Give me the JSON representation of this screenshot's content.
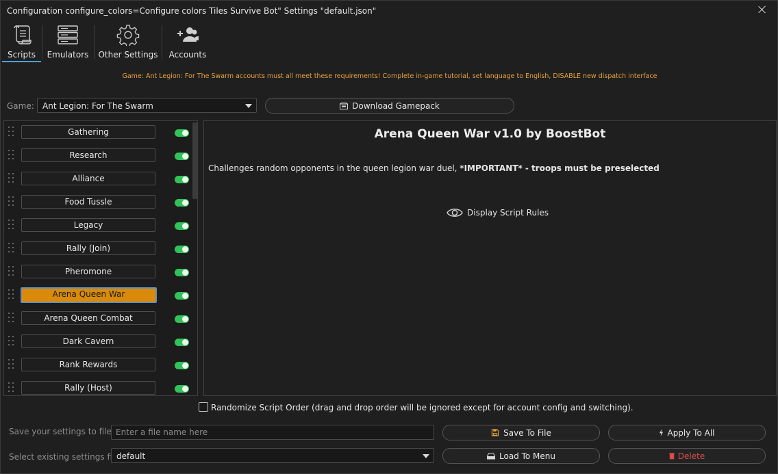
{
  "window": {
    "title": "Configuration configure_colors=Configure colors Tiles Survive Bot\" Settings \"default.json\""
  },
  "tabs": [
    {
      "label": "Scripts",
      "icon": "scroll-icon",
      "active": true
    },
    {
      "label": "Emulators",
      "icon": "server-icon",
      "active": false
    },
    {
      "label": "Other Settings",
      "icon": "gear-icon",
      "active": false
    },
    {
      "label": "Accounts",
      "icon": "users-add-icon",
      "active": false
    }
  ],
  "warning": "Game: Ant Legion: For The Swarm accounts must all meet these requirements! Complete in-game tutorial, set language to English, DISABLE new dispatch interface",
  "game": {
    "label": "Game:",
    "selected": "Ant Legion: For The Swarm",
    "download_label": "Download Gamepack"
  },
  "scripts": [
    {
      "label": "Gathering",
      "enabled": true,
      "selected": false
    },
    {
      "label": "Research",
      "enabled": true,
      "selected": false
    },
    {
      "label": "Alliance",
      "enabled": true,
      "selected": false
    },
    {
      "label": "Food Tussle",
      "enabled": true,
      "selected": false
    },
    {
      "label": "Legacy",
      "enabled": true,
      "selected": false
    },
    {
      "label": "Rally (Join)",
      "enabled": true,
      "selected": false
    },
    {
      "label": "Pheromone",
      "enabled": true,
      "selected": false
    },
    {
      "label": "Arena Queen War",
      "enabled": true,
      "selected": true
    },
    {
      "label": "Arena Queen Combat",
      "enabled": true,
      "selected": false
    },
    {
      "label": "Dark Cavern",
      "enabled": true,
      "selected": false
    },
    {
      "label": "Rank Rewards",
      "enabled": true,
      "selected": false
    },
    {
      "label": "Rally (Host)",
      "enabled": true,
      "selected": false
    }
  ],
  "detail": {
    "title": "Arena Queen War v1.0 by BoostBot",
    "description_plain": "Challenges random opponents in the queen legion war duel, ",
    "description_bold": "*IMPORTANT* - troops must be preselected",
    "rules_label": "Display Script Rules"
  },
  "randomize_label": "Randomize Script Order (drag and drop order will be ignored except for account config and switching).",
  "save_row": {
    "label": "Save your settings to file",
    "placeholder": "Enter a file name here",
    "save_label": "Save To File",
    "apply_label": "Apply To All"
  },
  "load_row": {
    "label": "Select existing settings file",
    "selected": "default",
    "load_label": "Load To Menu",
    "delete_label": "Delete"
  },
  "colors": {
    "accent": "#4aa3df",
    "warning": "#e8a33b",
    "selected_script": "#d98a0a",
    "toggle_on": "#33c25a",
    "danger": "#e04a4a"
  }
}
